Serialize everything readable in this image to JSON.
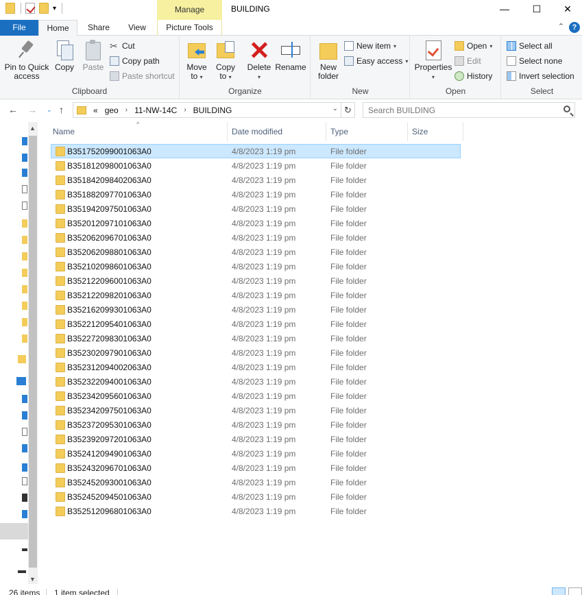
{
  "window": {
    "title": "BUILDING",
    "manage_label": "Manage",
    "minimize": "—",
    "maximize": "☐",
    "close": "✕"
  },
  "tabs": {
    "file": "File",
    "home": "Home",
    "share": "Share",
    "view": "View",
    "picture_tools": "Picture Tools",
    "collapse": "⌃",
    "help": "?"
  },
  "ribbon": {
    "clipboard": {
      "label": "Clipboard",
      "pin": "Pin to Quick access",
      "pin_line1": "Pin to Quick",
      "pin_line2": "access",
      "copy": "Copy",
      "paste": "Paste",
      "cut": "Cut",
      "copy_path": "Copy path",
      "paste_shortcut": "Paste shortcut"
    },
    "organize": {
      "label": "Organize",
      "move_to": "Move",
      "move_to2": "to",
      "copy_to": "Copy",
      "copy_to2": "to",
      "delete": "Delete",
      "rename": "Rename"
    },
    "new": {
      "label": "New",
      "new_folder1": "New",
      "new_folder2": "folder",
      "new_item": "New item",
      "easy_access": "Easy access"
    },
    "open": {
      "label": "Open",
      "properties": "Properties",
      "open": "Open",
      "edit": "Edit",
      "history": "History"
    },
    "select": {
      "label": "Select",
      "select_all": "Select all",
      "select_none": "Select none",
      "invert": "Invert selection"
    }
  },
  "address": {
    "overflow": "«",
    "segments": [
      "geo",
      "11-NW-14C",
      "BUILDING"
    ],
    "separator": "›"
  },
  "search": {
    "placeholder": "Search BUILDING"
  },
  "columns": {
    "name": "Name",
    "date": "Date modified",
    "type": "Type",
    "size": "Size"
  },
  "files": [
    {
      "name": "B351752099001063A0",
      "date": "4/8/2023 1:19 pm",
      "type": "File folder"
    },
    {
      "name": "B351812098001063A0",
      "date": "4/8/2023 1:19 pm",
      "type": "File folder"
    },
    {
      "name": "B351842098402063A0",
      "date": "4/8/2023 1:19 pm",
      "type": "File folder"
    },
    {
      "name": "B351882097701063A0",
      "date": "4/8/2023 1:19 pm",
      "type": "File folder"
    },
    {
      "name": "B351942097501063A0",
      "date": "4/8/2023 1:19 pm",
      "type": "File folder"
    },
    {
      "name": "B352012097101063A0",
      "date": "4/8/2023 1:19 pm",
      "type": "File folder"
    },
    {
      "name": "B352062096701063A0",
      "date": "4/8/2023 1:19 pm",
      "type": "File folder"
    },
    {
      "name": "B352062098801063A0",
      "date": "4/8/2023 1:19 pm",
      "type": "File folder"
    },
    {
      "name": "B352102098601063A0",
      "date": "4/8/2023 1:19 pm",
      "type": "File folder"
    },
    {
      "name": "B352122096001063A0",
      "date": "4/8/2023 1:19 pm",
      "type": "File folder"
    },
    {
      "name": "B352122098201063A0",
      "date": "4/8/2023 1:19 pm",
      "type": "File folder"
    },
    {
      "name": "B352162099301063A0",
      "date": "4/8/2023 1:19 pm",
      "type": "File folder"
    },
    {
      "name": "B352212095401063A0",
      "date": "4/8/2023 1:19 pm",
      "type": "File folder"
    },
    {
      "name": "B352272098301063A0",
      "date": "4/8/2023 1:19 pm",
      "type": "File folder"
    },
    {
      "name": "B352302097901063A0",
      "date": "4/8/2023 1:19 pm",
      "type": "File folder"
    },
    {
      "name": "B352312094002063A0",
      "date": "4/8/2023 1:19 pm",
      "type": "File folder"
    },
    {
      "name": "B352322094001063A0",
      "date": "4/8/2023 1:19 pm",
      "type": "File folder"
    },
    {
      "name": "B352342095601063A0",
      "date": "4/8/2023 1:19 pm",
      "type": "File folder"
    },
    {
      "name": "B352342097501063A0",
      "date": "4/8/2023 1:19 pm",
      "type": "File folder"
    },
    {
      "name": "B352372095301063A0",
      "date": "4/8/2023 1:19 pm",
      "type": "File folder"
    },
    {
      "name": "B352392097201063A0",
      "date": "4/8/2023 1:19 pm",
      "type": "File folder"
    },
    {
      "name": "B352412094901063A0",
      "date": "4/8/2023 1:19 pm",
      "type": "File folder"
    },
    {
      "name": "B352432096701063A0",
      "date": "4/8/2023 1:19 pm",
      "type": "File folder"
    },
    {
      "name": "B352452093001063A0",
      "date": "4/8/2023 1:19 pm",
      "type": "File folder"
    },
    {
      "name": "B352452094501063A0",
      "date": "4/8/2023 1:19 pm",
      "type": "File folder"
    },
    {
      "name": "B352512096801063A0",
      "date": "4/8/2023 1:19 pm",
      "type": "File folder"
    }
  ],
  "status": {
    "count": "26 items",
    "selected": "1 item selected"
  },
  "colors": {
    "accent": "#1a6fc0",
    "selection": "#cce8ff",
    "manage_tab": "#f6f0a0",
    "folder": "#f3cc5a"
  }
}
